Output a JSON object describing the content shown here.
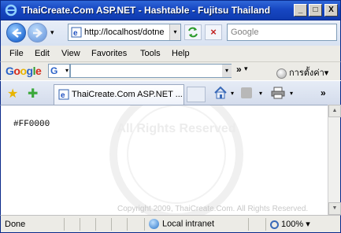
{
  "window": {
    "title": "ThaiCreate.Com ASP.NET - Hashtable - Fujitsu Thailand",
    "min_label": "_",
    "max_label": "□",
    "close_label": "X"
  },
  "address": {
    "url": "http://localhost/dotne",
    "search_placeholder": "Google",
    "stop_label": "×",
    "dropdown_glyph": "▾"
  },
  "menu": [
    "File",
    "Edit",
    "View",
    "Favorites",
    "Tools",
    "Help"
  ],
  "google_toolbar": {
    "logo_letters": [
      "G",
      "o",
      "o",
      "g",
      "l",
      "e"
    ],
    "logo_colors": [
      "#2a62c8",
      "#d42a1a",
      "#e8b400",
      "#2a62c8",
      "#2a9a2a",
      "#d42a1a"
    ],
    "selector_letter": "G",
    "chevron": "»",
    "settings_label": "การตั้งค่า"
  },
  "tabs": {
    "active_tab_label": "ThaiCreate.Com ASP.NET ...",
    "chevron": "»"
  },
  "content": {
    "page_text": "#FF0000",
    "watermark_text": "All Rights Reserved",
    "copyright": "Copyright 2009, ThaiCreate.Com. All Rights Reserved."
  },
  "status": {
    "text": "Done",
    "zone": "Local intranet",
    "zoom": "100%"
  },
  "colors": {
    "titlebar": "#1747c2",
    "accent": "#2d74d8"
  }
}
